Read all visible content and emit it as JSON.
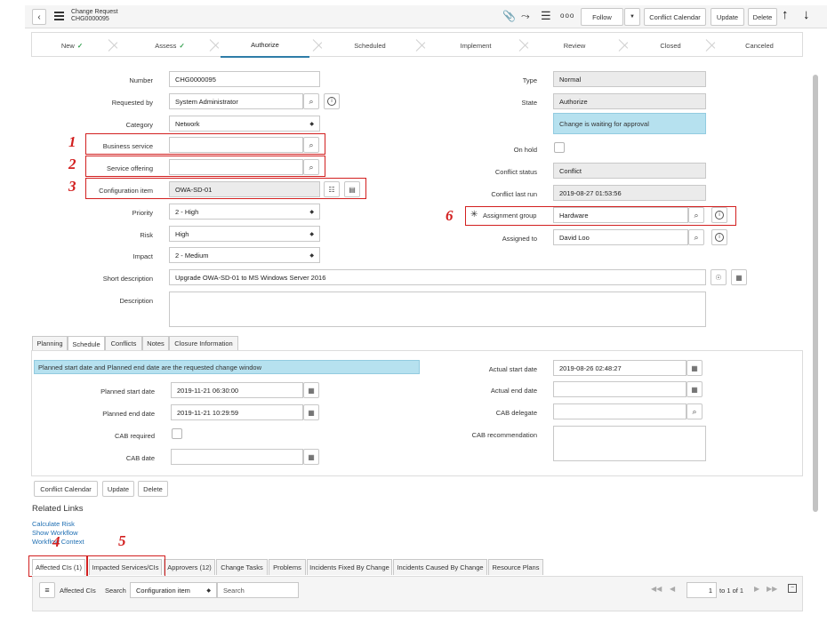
{
  "header": {
    "record_type": "Change Request",
    "record_number": "CHG0000095",
    "follow_label": "Follow",
    "conflict_calendar_label": "Conflict Calendar",
    "update_label": "Update",
    "delete_label": "Delete",
    "more_label": "ooo"
  },
  "stages": [
    {
      "label": "New",
      "done": "✓"
    },
    {
      "label": "Assess",
      "done": "✓"
    },
    {
      "label": "Authorize",
      "done": ""
    },
    {
      "label": "Scheduled",
      "done": ""
    },
    {
      "label": "Implement",
      "done": ""
    },
    {
      "label": "Review",
      "done": ""
    },
    {
      "label": "Closed",
      "done": ""
    },
    {
      "label": "Canceled",
      "done": ""
    }
  ],
  "form": {
    "number_label": "Number",
    "number_value": "CHG0000095",
    "requested_by_label": "Requested by",
    "requested_by_value": "System Administrator",
    "category_label": "Category",
    "category_value": "Network",
    "business_service_label": "Business service",
    "business_service_value": "",
    "service_offering_label": "Service offering",
    "service_offering_value": "",
    "config_item_label": "Configuration item",
    "config_item_value": "OWA-SD-01",
    "priority_label": "Priority",
    "priority_value": "2 - High",
    "risk_label": "Risk",
    "risk_value": "High",
    "impact_label": "Impact",
    "impact_value": "2 - Medium",
    "short_desc_label": "Short description",
    "short_desc_value": "Upgrade OWA-SD-01 to MS Windows Server 2016",
    "description_label": "Description",
    "description_value": "",
    "type_label": "Type",
    "type_value": "Normal",
    "state_label": "State",
    "state_value": "Authorize",
    "state_note": "Change is waiting for approval",
    "on_hold_label": "On hold",
    "conflict_status_label": "Conflict status",
    "conflict_status_value": "Conflict",
    "conflict_last_run_label": "Conflict last run",
    "conflict_last_run_value": "2019-08-27 01:53:56",
    "assignment_group_label": "Assignment group",
    "assignment_group_value": "Hardware",
    "assigned_to_label": "Assigned to",
    "assigned_to_value": "David Loo",
    "required_mark": "✳"
  },
  "form_tabs": [
    "Planning",
    "Schedule",
    "Conflicts",
    "Notes",
    "Closure Information"
  ],
  "schedule": {
    "info": "Planned start date and Planned end date are the requested change window",
    "planned_start_label": "Planned start date",
    "planned_start_value": "2019-11-21 06:30:00",
    "planned_end_label": "Planned end date",
    "planned_end_value": "2019-11-21 10:29:59",
    "cab_required_label": "CAB required",
    "cab_date_label": "CAB date",
    "cab_date_value": "",
    "actual_start_label": "Actual start date",
    "actual_start_value": "2019-08-26 02:48:27",
    "actual_end_label": "Actual end date",
    "actual_end_value": "",
    "cab_delegate_label": "CAB delegate",
    "cab_delegate_value": "",
    "cab_recommendation_label": "CAB recommendation",
    "cab_recommendation_value": ""
  },
  "bottom_buttons": {
    "conflict_calendar": "Conflict Calendar",
    "update": "Update",
    "delete": "Delete"
  },
  "related_links": {
    "title": "Related Links",
    "items": [
      "Calculate Risk",
      "Show Workflow",
      "Workflow Context"
    ]
  },
  "related_tabs": [
    "Affected CIs (1)",
    "Impacted Services/CIs",
    "Approvers (12)",
    "Change Tasks",
    "Problems",
    "Incidents Fixed By Change",
    "Incidents Caused By Change",
    "Resource Plans"
  ],
  "list_bar": {
    "title": "Affected CIs",
    "search_label": "Search",
    "search_field": "Configuration item",
    "search_placeholder": "Search",
    "page_value": "1",
    "page_of": "to 1 of 1"
  },
  "markers": [
    "1",
    "2",
    "3",
    "4",
    "5",
    "6"
  ],
  "colors": {
    "highlight": "#d21f1f",
    "info_bg": "#b6e1ef",
    "readonly_bg": "#ebebeb",
    "check": "#2e9d4a"
  }
}
